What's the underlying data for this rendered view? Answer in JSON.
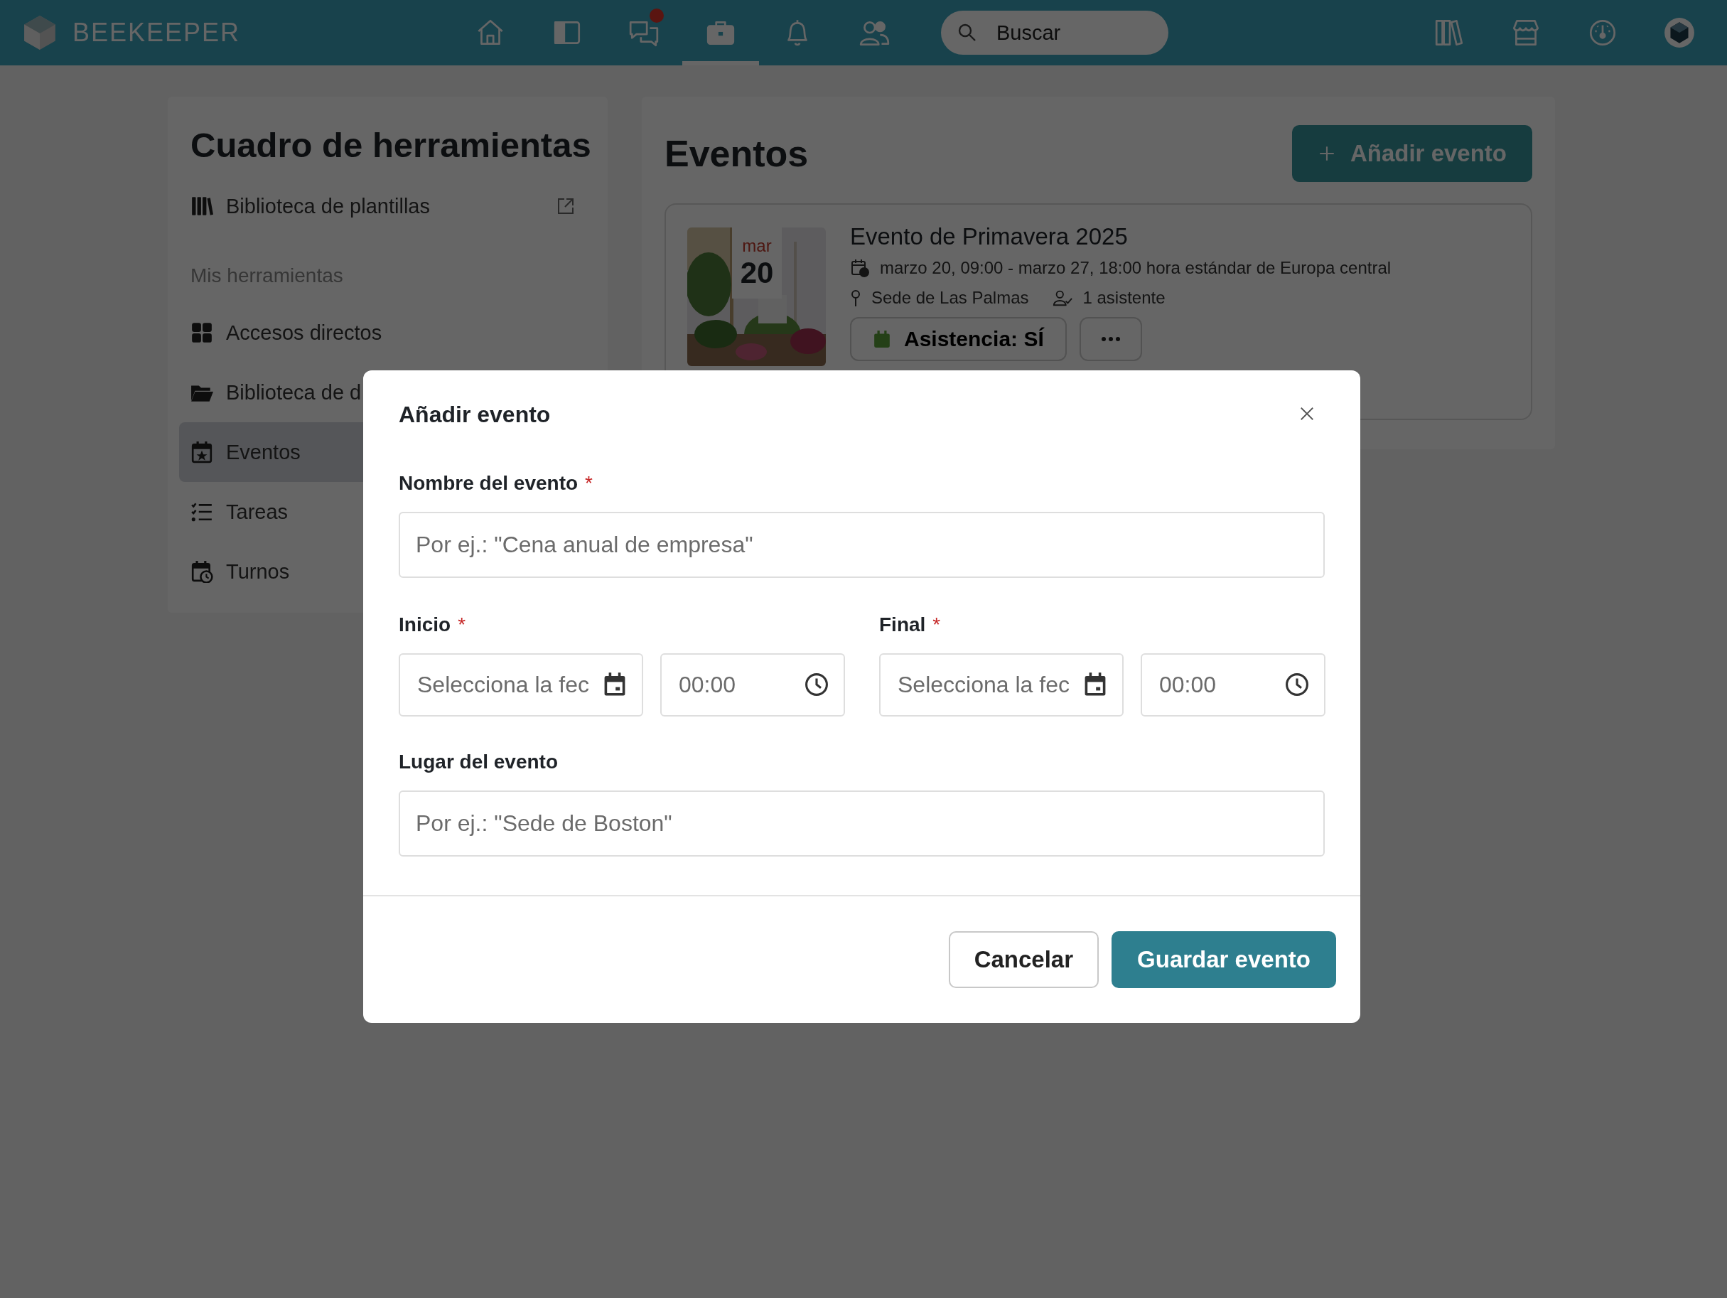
{
  "topbar": {
    "brand": "BEEKEEPER",
    "nav": [
      {
        "kind": "home",
        "selected": false
      },
      {
        "kind": "panel",
        "selected": false
      },
      {
        "kind": "chat",
        "selected": false,
        "badge": true
      },
      {
        "kind": "briefcase",
        "selected": true
      },
      {
        "kind": "bell",
        "selected": false
      },
      {
        "kind": "people",
        "selected": false
      }
    ],
    "search": {
      "placeholder": "Buscar"
    },
    "tools": [
      {
        "kind": "books"
      },
      {
        "kind": "store"
      },
      {
        "kind": "gauge"
      },
      {
        "kind": "avatar"
      }
    ]
  },
  "sidebar": {
    "title": "Cuadro de herramientas",
    "featured": {
      "label": "Biblioteca de plantillas",
      "external": true
    },
    "section": "Mis herramientas",
    "items": [
      {
        "kind": "grid",
        "label": "Accesos directos",
        "selected": false
      },
      {
        "kind": "folder",
        "label": "Biblioteca de d",
        "selected": false
      },
      {
        "kind": "calendar",
        "label": "Eventos",
        "selected": true
      },
      {
        "kind": "tasks",
        "label": "Tareas",
        "selected": false
      },
      {
        "kind": "shifts",
        "label": "Turnos",
        "selected": false
      }
    ]
  },
  "events": {
    "title": "Eventos",
    "add_button": "Añadir evento",
    "items": [
      {
        "month": "mar",
        "day": "20",
        "title": "Evento de Primavera 2025",
        "dates": "marzo 20, 09:00 - marzo 27, 18:00 hora estándar de Europa central",
        "location": "Sede de Las Palmas",
        "attendees": "1 asistente",
        "rsvp": "Asistencia: SÍ"
      }
    ]
  },
  "dialog": {
    "title": "Añadir evento",
    "name_field": {
      "label": "Nombre del evento",
      "required_mark": "*",
      "placeholder": "Por ej.: \"Cena anual de empresa\""
    },
    "start": {
      "label": "Inicio",
      "required_mark": "*",
      "date_placeholder": "Selecciona la fec",
      "time_placeholder": "00:00"
    },
    "end": {
      "label": "Final",
      "required_mark": "*",
      "date_placeholder": "Selecciona la fec",
      "time_placeholder": "00:00"
    },
    "location_field": {
      "label": "Lugar del evento",
      "placeholder": "Por ej.: \"Sede de Boston\""
    },
    "buttons": [
      {
        "kind": "secondary",
        "label": "Cancelar"
      },
      {
        "kind": "primary",
        "label": "Guardar evento"
      }
    ]
  }
}
